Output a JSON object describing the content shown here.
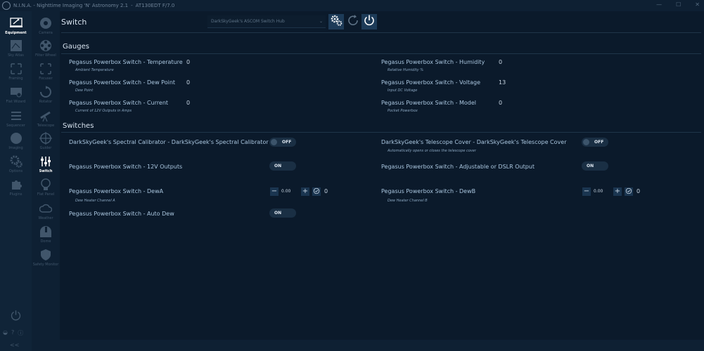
{
  "window": {
    "app_name": "N.I.N.A. - Nighttime Imaging 'N' Astronomy 2.1",
    "separator": "-",
    "profile": "AT130EDT F/7.0",
    "minimize": "—",
    "maximize": "☐",
    "close": "✕"
  },
  "nav_primary": [
    {
      "label": "Equipment",
      "icon": "equipment-icon",
      "active": true
    },
    {
      "label": "Sky Atlas",
      "icon": "sky-atlas-icon"
    },
    {
      "label": "Framing",
      "icon": "framing-icon"
    },
    {
      "label": "Flat Wizard",
      "icon": "flat-wizard-icon"
    },
    {
      "label": "Sequencer",
      "icon": "sequencer-icon"
    },
    {
      "label": "Imaging",
      "icon": "imaging-icon"
    },
    {
      "label": "Options",
      "icon": "options-icon"
    },
    {
      "label": "Plugins",
      "icon": "plugins-icon"
    }
  ],
  "nav_equipment": [
    {
      "label": "Camera",
      "icon": "camera-icon"
    },
    {
      "label": "Filter Wheel",
      "icon": "filter-wheel-icon"
    },
    {
      "label": "Focuser",
      "icon": "focuser-icon"
    },
    {
      "label": "Rotator",
      "icon": "rotator-icon"
    },
    {
      "label": "Telescope",
      "icon": "telescope-icon"
    },
    {
      "label": "Guider",
      "icon": "guider-icon"
    },
    {
      "label": "Switch",
      "icon": "switch-icon",
      "active": true
    },
    {
      "label": "Flat Panel",
      "icon": "flat-panel-icon"
    },
    {
      "label": "Weather",
      "icon": "weather-icon"
    },
    {
      "label": "Dome",
      "icon": "dome-icon"
    },
    {
      "label": "Safety Monitor",
      "icon": "safety-monitor-icon"
    }
  ],
  "sidebar_bottom": {
    "power": "⏻",
    "icons": [
      "◒",
      "?",
      "ⓘ"
    ],
    "collapse": "<<"
  },
  "header": {
    "title": "Switch",
    "hub_selected": "DarkSkyGeek's ASCOM Switch Hub"
  },
  "gauges": {
    "title": "Gauges",
    "left": [
      {
        "name": "Pegasus Powerbox Switch - Temperature",
        "desc": "Ambient Temperature",
        "value": "0"
      },
      {
        "name": "Pegasus Powerbox Switch - Dew Point",
        "desc": "Dew Point",
        "value": "0"
      },
      {
        "name": "Pegasus Powerbox Switch - Current",
        "desc": "Current of 12V Outputs in Amps",
        "value": "0"
      }
    ],
    "right": [
      {
        "name": "Pegasus Powerbox Switch - Humidity",
        "desc": "Relative Humidity %",
        "value": "0"
      },
      {
        "name": "Pegasus Powerbox Switch - Voltage",
        "desc": "Input DC Voltage",
        "value": "13"
      },
      {
        "name": "Pegasus Powerbox Switch - Model",
        "desc": "Pocket Powerbox",
        "value": "0"
      }
    ]
  },
  "switches": {
    "title": "Switches",
    "left": [
      {
        "name": "DarkSkyGeek's Spectral Calibrator - DarkSkyGeek's Spectral Calibrator",
        "desc": "",
        "type": "toggle",
        "state": "OFF"
      },
      {
        "name": "Pegasus Powerbox Switch - 12V Outputs",
        "desc": "",
        "type": "toggle",
        "state": "ON"
      },
      {
        "name": "Pegasus Powerbox Switch - DewA",
        "desc": "Dew Heater Channel A",
        "type": "stepper",
        "input": "0.00",
        "value": "0"
      },
      {
        "name": "Pegasus Powerbox Switch - Auto Dew",
        "desc": "",
        "type": "toggle",
        "state": "ON"
      }
    ],
    "right": [
      {
        "name": "DarkSkyGeek's Telescope Cover - DarkSkyGeek's Telescope Cover",
        "desc": "Automatically opens or closes the telescope cover",
        "type": "toggle",
        "state": "OFF"
      },
      {
        "name": "Pegasus Powerbox Switch - Adjustable or DSLR Output",
        "desc": "",
        "type": "toggle",
        "state": "ON"
      },
      {
        "name": "Pegasus Powerbox Switch - DewB",
        "desc": "Dew Heater Channel B",
        "type": "stepper",
        "input": "0.00",
        "value": "0"
      }
    ]
  },
  "stepper_labels": {
    "minus": "−",
    "plus": "+"
  },
  "colors": {
    "background": "#0b1a2b",
    "accent": "#1d3b58",
    "label": "#a9c5de"
  }
}
